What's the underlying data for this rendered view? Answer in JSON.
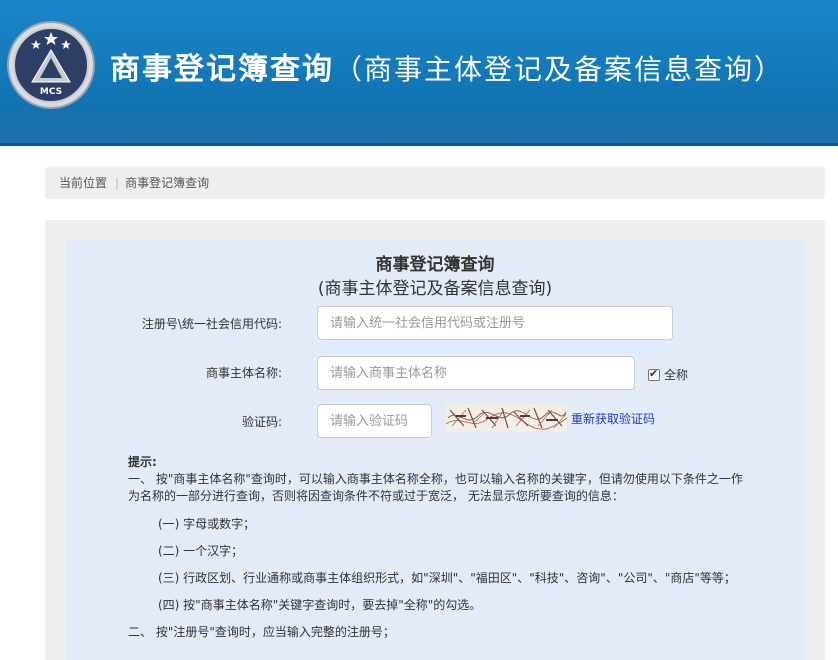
{
  "header": {
    "title_main": "商事登记簿查询",
    "title_sub": "（商事主体登记及备案信息查询）",
    "logo_text": "MCS"
  },
  "breadcrumb": {
    "label": "当前位置",
    "current": "商事登记簿查询"
  },
  "form": {
    "title": "商事登记簿查询",
    "subtitle": "(商事主体登记及备案信息查询)",
    "fields": {
      "reg_no": {
        "label": "注册号\\统一社会信用代码:",
        "placeholder": "请输入统一社会信用代码或注册号",
        "value": ""
      },
      "name": {
        "label": "商事主体名称:",
        "placeholder": "请输入商事主体名称",
        "value": ""
      },
      "captcha": {
        "label": "验证码:",
        "placeholder": "请输入验证码",
        "value": ""
      }
    },
    "fullname_checkbox": {
      "label": "全称",
      "checked": true
    },
    "refresh_captcha": "重新获取验证码"
  },
  "tips": {
    "title": "提示:",
    "item1": "一、 按\"商事主体名称\"查询时，可以输入商事主体名称全称，也可以输入名称的关键字，但请勿使用以下条件之一作为名称的一部分进行查询，否则将因查询条件不符或过于宽泛， 无法显示您所要查询的信息：",
    "sub1": "(一) 字母或数字；",
    "sub2": "(二) 一个汉字；",
    "sub3": "(三) 行政区划、行业通称或商事主体组织形式，如\"深圳\"、\"福田区\"、\"科技\"、咨询\"、\"公司\"、\"商店\"等等；",
    "sub4": "(四) 按\"商事主体名称\"关键字查询时，要去掉\"全称\"的勾选。",
    "item2": "二、 按\"注册号\"查询时，应当输入完整的注册号；"
  },
  "colors": {
    "header_blue": "#1378b8",
    "panel_bg": "#e3eaf8",
    "link_blue": "#1a3fc4"
  }
}
